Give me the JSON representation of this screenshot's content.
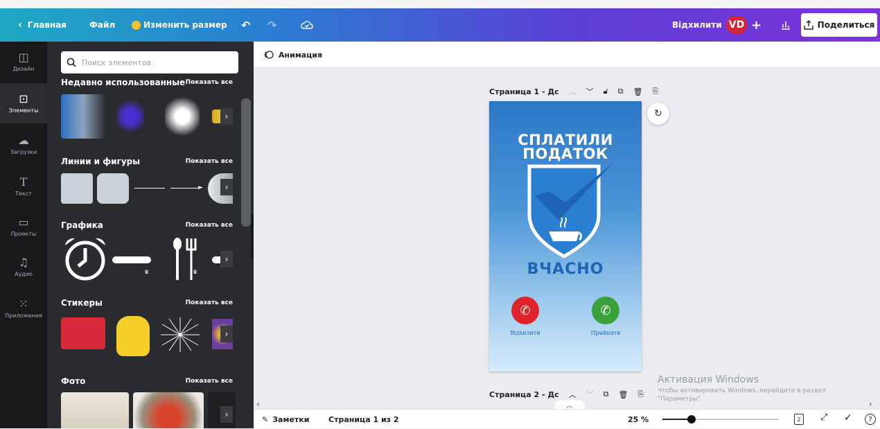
{
  "topbar": {
    "home": "Главная",
    "file": "Файл",
    "resize": "Изменить размер",
    "reject": "Відхилити",
    "avatar_initials": "VD",
    "share": "Поделиться"
  },
  "rail": {
    "items": [
      {
        "label": "Дизайн",
        "icon": "layout-icon"
      },
      {
        "label": "Элементы",
        "icon": "shapes-icon"
      },
      {
        "label": "Загрузки",
        "icon": "cloud-upload-icon"
      },
      {
        "label": "Текст",
        "icon": "text-icon"
      },
      {
        "label": "Проекты",
        "icon": "folder-icon"
      },
      {
        "label": "Аудио",
        "icon": "music-icon"
      },
      {
        "label": "Приложения",
        "icon": "apps-grid-icon"
      }
    ]
  },
  "panel": {
    "search_placeholder": "Поиск элементов",
    "sections": [
      {
        "title": "Недавно использованные",
        "more": "Показать все"
      },
      {
        "title": "Линии и фигуры",
        "more": "Показать все"
      },
      {
        "title": "Графика",
        "more": "Показать все"
      },
      {
        "title": "Стикеры",
        "more": "Показать все"
      },
      {
        "title": "Фото",
        "more": "Показать все"
      }
    ]
  },
  "toolbar": {
    "animation": "Анимация"
  },
  "canvas": {
    "page1_label": "Страница 1 - Дс",
    "page2_label": "Страница 2 - Дс",
    "design": {
      "headline_line1": "СПЛАТИЛИ",
      "headline_line2": "ПОДАТОК",
      "tagline": "ВЧАСНО",
      "decline_label": "Відхилити",
      "accept_label": "Прийняти"
    }
  },
  "watermark": {
    "title": "Активация Windows",
    "text": "Чтобы активировать Windows, перейдите в раздел \"Параметры\"."
  },
  "bottombar": {
    "notes": "Заметки",
    "page_count": "Страница 1 из 2",
    "zoom": "25 %",
    "zoom_fraction": 0.25,
    "page_badge": "2"
  },
  "colors": {
    "decline": "#e0232b",
    "accept": "#3aa13a",
    "design_blue": "#1f64b4"
  }
}
